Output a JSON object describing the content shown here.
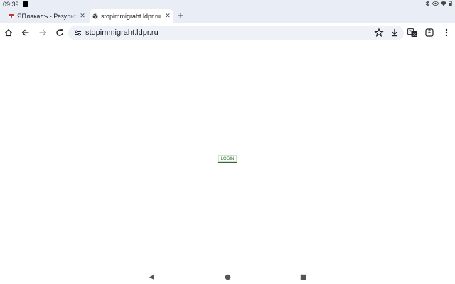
{
  "status": {
    "time": "09:39",
    "icons": [
      "bluetooth-icon",
      "eye-icon",
      "wifi-icon",
      "battery-icon"
    ]
  },
  "tabs": [
    {
      "title": "ЯПлакалъ - Результа",
      "close": "✕",
      "favicon": "yaplakal-favicon-icon"
    },
    {
      "title": "stopimmigraht.ldpr.ru",
      "close": "✕",
      "favicon": "globe-icon",
      "active": true
    }
  ],
  "new_tab": "+",
  "toolbar": {
    "url": "stopimmigraht.ldpr.ru",
    "tab_count": "2",
    "icons": [
      "home-icon",
      "back-icon",
      "forward-icon",
      "reload-icon",
      "site-settings-icon",
      "bookmark-star-icon",
      "download-icon",
      "translate-icon",
      "menu-icon"
    ]
  },
  "page": {
    "login_label": "LOGIN",
    "login_color": "#2e6b34"
  },
  "nav": {
    "icons": [
      "back-triangle-icon",
      "home-circle-icon",
      "recents-square-icon"
    ]
  },
  "colors": {
    "chrome_bg": "#e8edf6",
    "omnibox_bg": "#eef1f8"
  }
}
